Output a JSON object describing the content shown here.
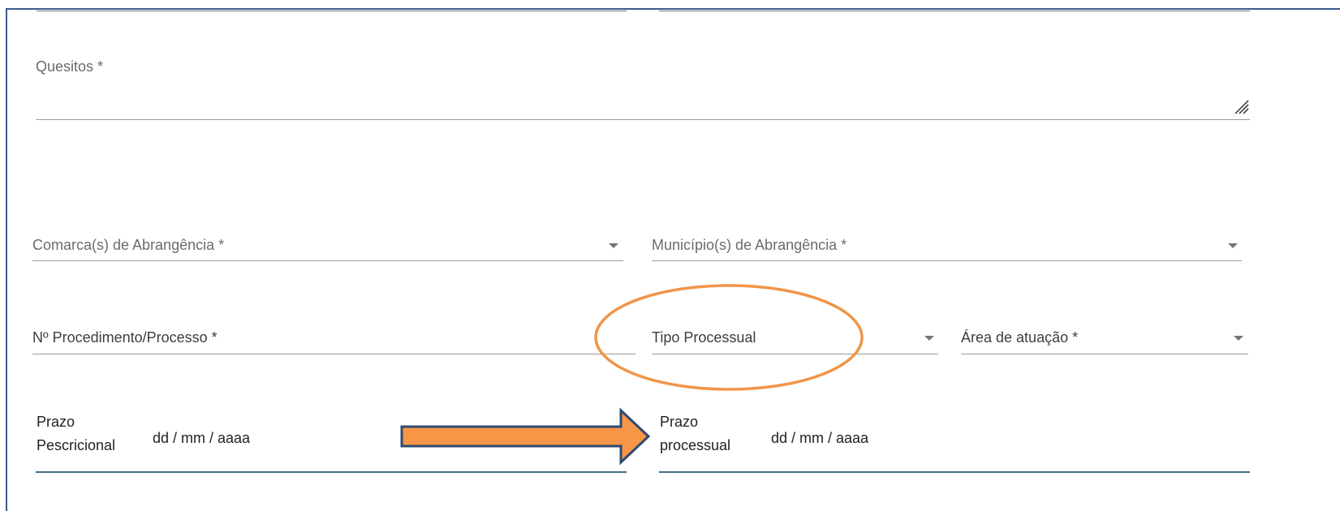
{
  "form": {
    "quesitos": {
      "label": "Quesitos *"
    },
    "comarca": {
      "label": "Comarca(s) de Abrangência *"
    },
    "municipio": {
      "label": "Município(s) de Abrangência *"
    },
    "procedimento": {
      "label": "Nº Procedimento/Processo *"
    },
    "tipo_processual": {
      "label": "Tipo Processual"
    },
    "area_atuacao": {
      "label": "Área de atuação *"
    },
    "prazo_prescricional": {
      "label_line1": "Prazo",
      "label_line2": "Pescricional",
      "placeholder": "dd / mm / aaaa"
    },
    "prazo_processual": {
      "label_line1": "Prazo",
      "label_line2": "processual",
      "placeholder": "dd / mm / aaaa"
    }
  },
  "colors": {
    "annotation_orange": "#f0954a",
    "arrow_fill": "#f79646",
    "arrow_border": "#2c4a72",
    "frame_border": "#3a5a8c"
  },
  "icons": {
    "resize": "resize-handle-icon",
    "dropdown": "chevron-down-icon",
    "arrow": "arrow-right-icon"
  }
}
